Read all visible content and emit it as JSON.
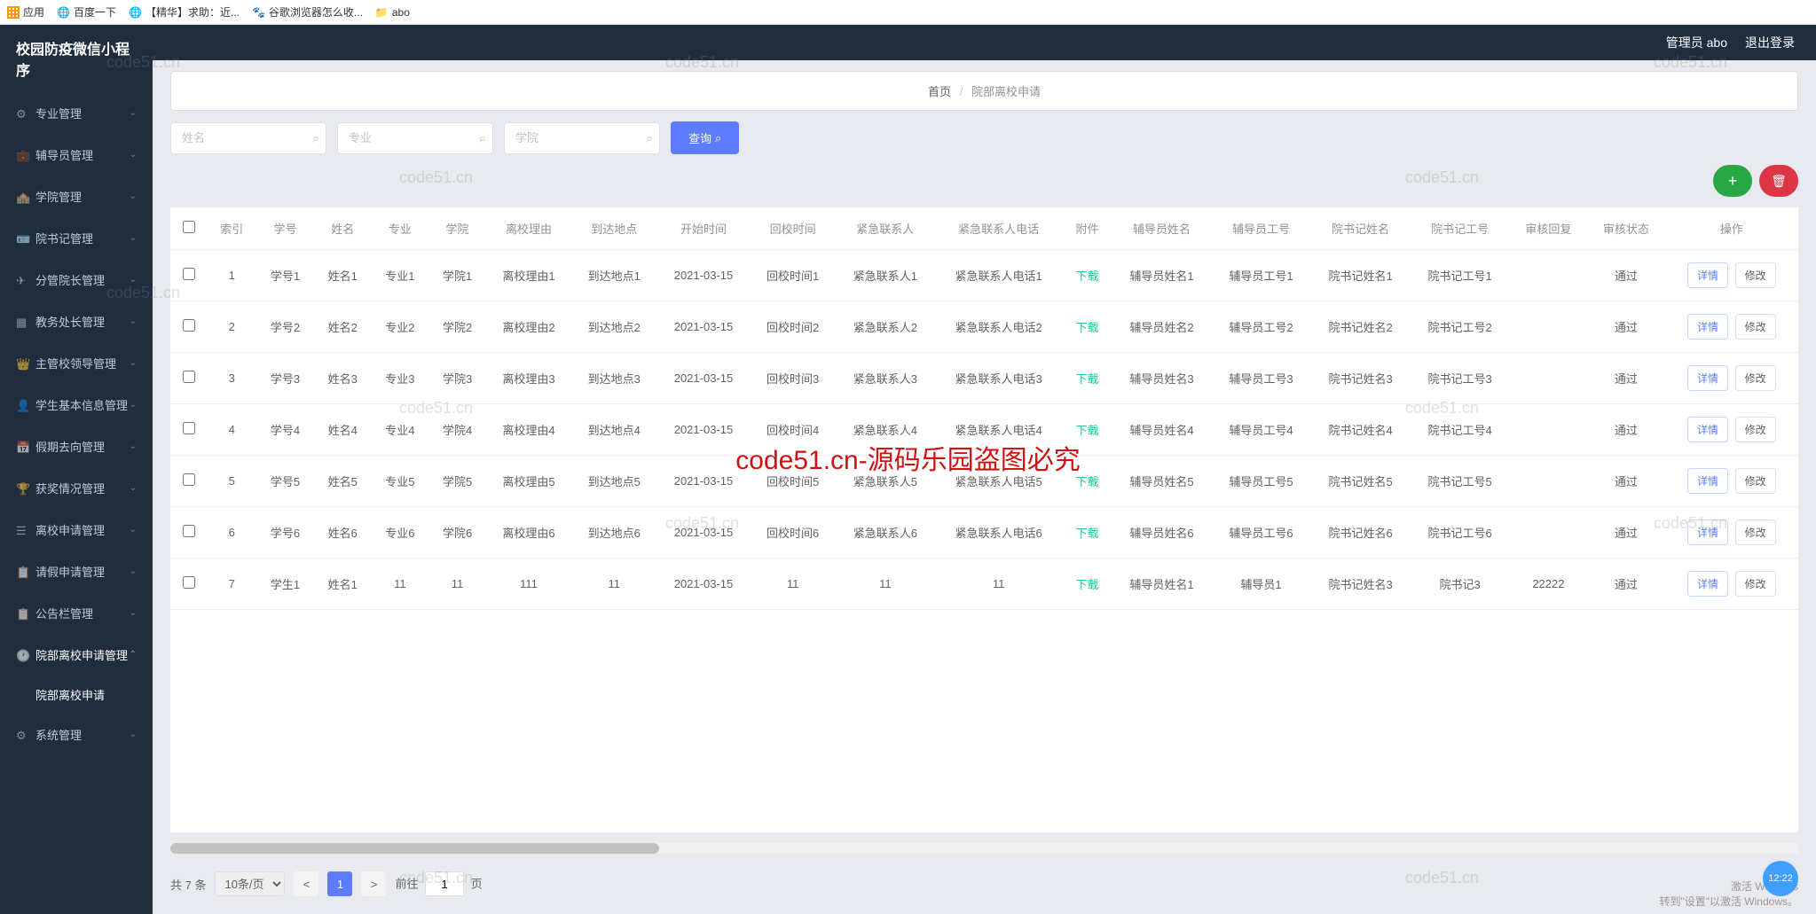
{
  "browser": {
    "apps": "应用",
    "baidu": "百度一下",
    "jinghua": "【精华】求助：近...",
    "google": "谷歌浏览器怎么收...",
    "abo": "abo"
  },
  "app": {
    "title": "校园防疫微信小程序",
    "admin": "管理员 abo",
    "logout": "退出登录"
  },
  "menu": {
    "m0": "专业管理",
    "m1": "辅导员管理",
    "m2": "学院管理",
    "m3": "院书记管理",
    "m4": "分管院长管理",
    "m5": "教务处长管理",
    "m6": "主管校领导管理",
    "m7": "学生基本信息管理",
    "m8": "假期去向管理",
    "m9": "获奖情况管理",
    "m10": "离校申请管理",
    "m11": "请假申请管理",
    "m12": "公告栏管理",
    "m13": "院部离校申请管理",
    "m13sub": "院部离校申请",
    "m14": "系统管理"
  },
  "breadcrumb": {
    "home": "首页",
    "cur": "院部离校申请"
  },
  "search": {
    "name": "姓名",
    "major": "专业",
    "college": "学院",
    "query": "查询"
  },
  "table": {
    "headers": {
      "idx": "索引",
      "sno": "学号",
      "name": "姓名",
      "major": "专业",
      "college": "学院",
      "reason": "离校理由",
      "dest": "到达地点",
      "start": "开始时间",
      "back": "回校时间",
      "contact": "紧急联系人",
      "phone": "紧急联系人电话",
      "attach": "附件",
      "fdyName": "辅导员姓名",
      "fdyNo": "辅导员工号",
      "ysjName": "院书记姓名",
      "ysjNo": "院书记工号",
      "reply": "审核回复",
      "status": "审核状态",
      "op": "操作"
    },
    "download": "下载",
    "detail": "详情",
    "edit": "修改",
    "rows": [
      {
        "idx": "1",
        "sno": "学号1",
        "name": "姓名1",
        "major": "专业1",
        "college": "学院1",
        "reason": "离校理由1",
        "dest": "到达地点1",
        "start": "2021-03-15",
        "back": "回校时间1",
        "contact": "紧急联系人1",
        "phone": "紧急联系人电话1",
        "fdyName": "辅导员姓名1",
        "fdyNo": "辅导员工号1",
        "ysjName": "院书记姓名1",
        "ysjNo": "院书记工号1",
        "reply": "",
        "status": "通过"
      },
      {
        "idx": "2",
        "sno": "学号2",
        "name": "姓名2",
        "major": "专业2",
        "college": "学院2",
        "reason": "离校理由2",
        "dest": "到达地点2",
        "start": "2021-03-15",
        "back": "回校时间2",
        "contact": "紧急联系人2",
        "phone": "紧急联系人电话2",
        "fdyName": "辅导员姓名2",
        "fdyNo": "辅导员工号2",
        "ysjName": "院书记姓名2",
        "ysjNo": "院书记工号2",
        "reply": "",
        "status": "通过"
      },
      {
        "idx": "3",
        "sno": "学号3",
        "name": "姓名3",
        "major": "专业3",
        "college": "学院3",
        "reason": "离校理由3",
        "dest": "到达地点3",
        "start": "2021-03-15",
        "back": "回校时间3",
        "contact": "紧急联系人3",
        "phone": "紧急联系人电话3",
        "fdyName": "辅导员姓名3",
        "fdyNo": "辅导员工号3",
        "ysjName": "院书记姓名3",
        "ysjNo": "院书记工号3",
        "reply": "",
        "status": "通过"
      },
      {
        "idx": "4",
        "sno": "学号4",
        "name": "姓名4",
        "major": "专业4",
        "college": "学院4",
        "reason": "离校理由4",
        "dest": "到达地点4",
        "start": "2021-03-15",
        "back": "回校时间4",
        "contact": "紧急联系人4",
        "phone": "紧急联系人电话4",
        "fdyName": "辅导员姓名4",
        "fdyNo": "辅导员工号4",
        "ysjName": "院书记姓名4",
        "ysjNo": "院书记工号4",
        "reply": "",
        "status": "通过"
      },
      {
        "idx": "5",
        "sno": "学号5",
        "name": "姓名5",
        "major": "专业5",
        "college": "学院5",
        "reason": "离校理由5",
        "dest": "到达地点5",
        "start": "2021-03-15",
        "back": "回校时间5",
        "contact": "紧急联系人5",
        "phone": "紧急联系人电话5",
        "fdyName": "辅导员姓名5",
        "fdyNo": "辅导员工号5",
        "ysjName": "院书记姓名5",
        "ysjNo": "院书记工号5",
        "reply": "",
        "status": "通过"
      },
      {
        "idx": "6",
        "sno": "学号6",
        "name": "姓名6",
        "major": "专业6",
        "college": "学院6",
        "reason": "离校理由6",
        "dest": "到达地点6",
        "start": "2021-03-15",
        "back": "回校时间6",
        "contact": "紧急联系人6",
        "phone": "紧急联系人电话6",
        "fdyName": "辅导员姓名6",
        "fdyNo": "辅导员工号6",
        "ysjName": "院书记姓名6",
        "ysjNo": "院书记工号6",
        "reply": "",
        "status": "通过"
      },
      {
        "idx": "7",
        "sno": "学生1",
        "name": "姓名1",
        "major": "11",
        "college": "11",
        "reason": "111",
        "dest": "11",
        "start": "2021-03-15",
        "back": "11",
        "contact": "11",
        "phone": "11",
        "fdyName": "辅导员姓名1",
        "fdyNo": "辅导员1",
        "ysjName": "院书记姓名3",
        "ysjNo": "院书记3",
        "reply": "22222",
        "status": "通过"
      }
    ]
  },
  "pagination": {
    "total": "共 7 条",
    "perpage": "10条/页",
    "page": "1",
    "goto": "前往",
    "pagelabel": "页",
    "jumpval": "1"
  },
  "footer": {
    "activate": "激活 Windows",
    "hint": "转到\"设置\"以激活 Windows。",
    "clock": "12:22"
  },
  "watermark": "code51.cn",
  "wmred": "code51.cn-源码乐园盗图必究"
}
